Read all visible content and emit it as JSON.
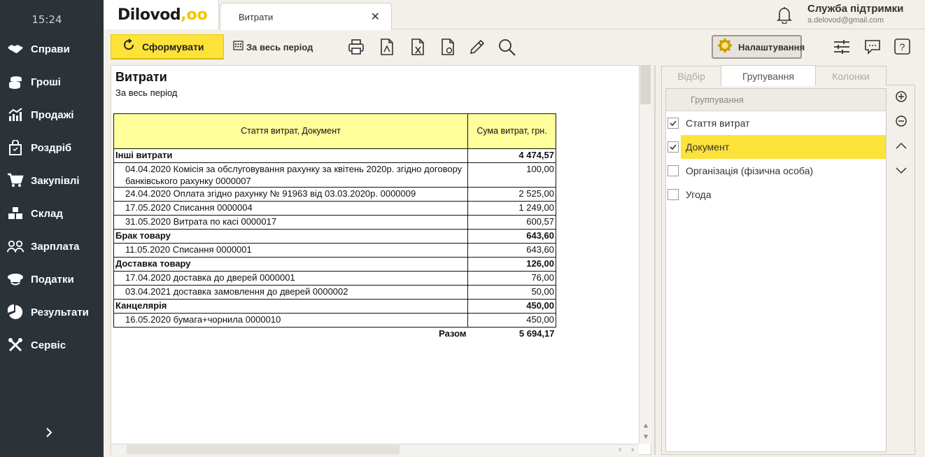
{
  "sidebar": {
    "time": "15:24",
    "items": [
      {
        "label": "Справи",
        "icon": "handshake-icon"
      },
      {
        "label": "Гроші",
        "icon": "coins-icon"
      },
      {
        "label": "Продажі",
        "icon": "sales-chart-icon"
      },
      {
        "label": "Роздріб",
        "icon": "shopping-bag-icon"
      },
      {
        "label": "Закупівлі",
        "icon": "cart-icon"
      },
      {
        "label": "Склад",
        "icon": "warehouse-boxes-icon"
      },
      {
        "label": "Зарплата",
        "icon": "people-icon"
      },
      {
        "label": "Податки",
        "icon": "officer-cap-icon"
      },
      {
        "label": "Результати",
        "icon": "pie-chart-icon"
      },
      {
        "label": "Сервіс",
        "icon": "tools-icon"
      }
    ],
    "collapse_icon": "chevron-right-icon"
  },
  "header": {
    "logo_text": "Dilovod",
    "logo_dots": ",oo",
    "tab_title": "Витрати",
    "support_title": "Служба підтримки",
    "support_email": "a.delovod@gmail.com"
  },
  "toolbar": {
    "form_label": "Сформувати",
    "period_label": "За весь період",
    "settings_label": "Налаштування"
  },
  "report": {
    "title": "Витрати",
    "subtitle": "За весь період",
    "col_item": "Стаття витрат, Документ",
    "col_sum": "Сума витрат, грн.",
    "rows": [
      {
        "type": "grp",
        "name": "Інші витрати",
        "sum": "4 474,57"
      },
      {
        "type": "doc",
        "name": "04.04.2020 Комісія за обслуговування рахунку за квітень  2020р. згідно договору банківського рахунку 0000007",
        "sum": "100,00"
      },
      {
        "type": "doc",
        "name": "24.04.2020 Оплата згідно рахунку № 91963 від 03.03.2020р. 0000009",
        "sum": "2 525,00"
      },
      {
        "type": "doc",
        "name": "17.05.2020 Списання 0000004",
        "sum": "1 249,00"
      },
      {
        "type": "doc",
        "name": "31.05.2020 Витрата по касі 0000017",
        "sum": "600,57"
      },
      {
        "type": "grp",
        "name": "Брак товару",
        "sum": "643,60"
      },
      {
        "type": "doc",
        "name": "11.05.2020 Списання 0000001",
        "sum": "643,60"
      },
      {
        "type": "grp",
        "name": "Доставка товару",
        "sum": "126,00"
      },
      {
        "type": "doc",
        "name": "17.04.2020 доставка до дверей 0000001",
        "sum": "76,00"
      },
      {
        "type": "doc",
        "name": "03.04.2021 доставка замовлення до дверей 0000002",
        "sum": "50,00"
      },
      {
        "type": "grp",
        "name": "Канцелярія",
        "sum": "450,00"
      },
      {
        "type": "doc",
        "name": "16.05.2020 бумага+чорнила 0000010",
        "sum": "450,00"
      }
    ],
    "total_label": "Разом",
    "total_sum": "5 694,17"
  },
  "panel": {
    "tabs": [
      "Відбір",
      "Групування",
      "Колонки"
    ],
    "active_tab": "Групування",
    "list_header": "Группування",
    "items": [
      {
        "label": "Стаття витрат",
        "checked": true,
        "selected": false
      },
      {
        "label": "Документ",
        "checked": true,
        "selected": true
      },
      {
        "label": "Організація (фізична особа)",
        "checked": false,
        "selected": false
      },
      {
        "label": "Угода",
        "checked": false,
        "selected": false
      }
    ]
  },
  "colors": {
    "accent": "#fde23a",
    "sidebar_bg": "#2b3238",
    "header_cell_bg": "#fefe9a"
  }
}
